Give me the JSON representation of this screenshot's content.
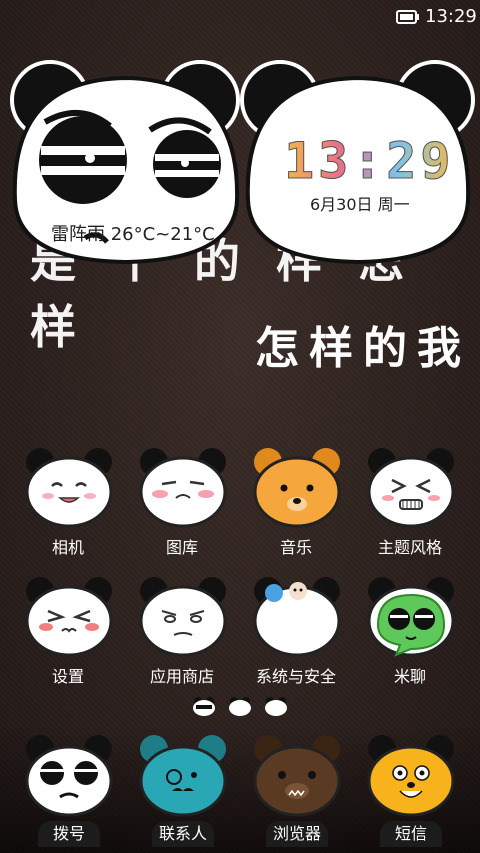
{
  "status_bar": {
    "time": "13:29",
    "battery_icon": "battery-icon"
  },
  "wallpaper": {
    "line1": "是 千 的 样 怎 样",
    "line2": "怎样的我"
  },
  "weather": {
    "text": "雷阵雨 26°C~21°C"
  },
  "clock": {
    "time": "13:29",
    "date": "6月30日 周一"
  },
  "apps": [
    {
      "label": "相机"
    },
    {
      "label": "图库"
    },
    {
      "label": "音乐"
    },
    {
      "label": "主题风格"
    },
    {
      "label": "设置"
    },
    {
      "label": "应用商店"
    },
    {
      "label": "系统与安全"
    },
    {
      "label": "米聊"
    }
  ],
  "page_indicator": {
    "pages": 3,
    "current": 1
  },
  "dock": [
    {
      "label": "拨号"
    },
    {
      "label": "联系人"
    },
    {
      "label": "浏览器"
    },
    {
      "label": "短信"
    }
  ],
  "colors": {
    "panda_white": "#ffffff",
    "panda_black": "#111111",
    "music_face": "#f5a63c",
    "contacts_face": "#2aa7b5",
    "browser_face": "#5a3a22",
    "sms_face": "#f7b21c"
  }
}
